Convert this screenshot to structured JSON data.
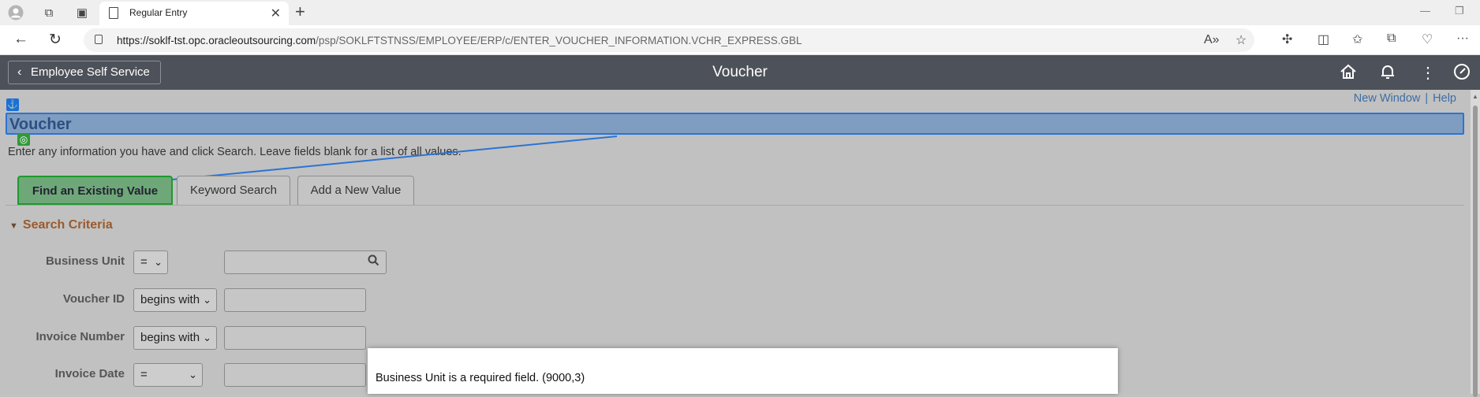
{
  "browser": {
    "tab_title": "Regular Entry",
    "url_host": "https://soklf-tst.opc.oracleoutsourcing.com",
    "url_path": "/psp/SOKLFTSTNSS/EMPLOYEE/ERP/c/ENTER_VOUCHER_INFORMATION.VCHR_EXPRESS.GBL"
  },
  "header": {
    "back_label": "Employee Self Service",
    "title": "Voucher"
  },
  "links": {
    "new_window": "New Window",
    "separator": "|",
    "help": "Help"
  },
  "page": {
    "title": "Voucher",
    "instruction": "Enter any information you have and click Search. Leave fields blank for a list of all values."
  },
  "tabs": [
    {
      "label": "Find an Existing Value"
    },
    {
      "label": "Keyword Search"
    },
    {
      "label": "Add a New Value"
    }
  ],
  "search": {
    "section_title": "Search Criteria",
    "fields": [
      {
        "label": "Business Unit",
        "operator": "=",
        "value": ""
      },
      {
        "label": "Voucher ID",
        "operator": "begins with",
        "value": ""
      },
      {
        "label": "Invoice Number",
        "operator": "begins with",
        "value": ""
      },
      {
        "label": "Invoice Date",
        "operator": "=",
        "value": ""
      }
    ]
  },
  "dialog": {
    "message": "Business Unit is a required field. (9000,3)"
  },
  "colors": {
    "header_bg": "#4d5159",
    "highlight": "#2b73d4",
    "active_tab": "#1f9a2e",
    "section_title": "#9a5a2e",
    "link": "#3f6da3"
  }
}
